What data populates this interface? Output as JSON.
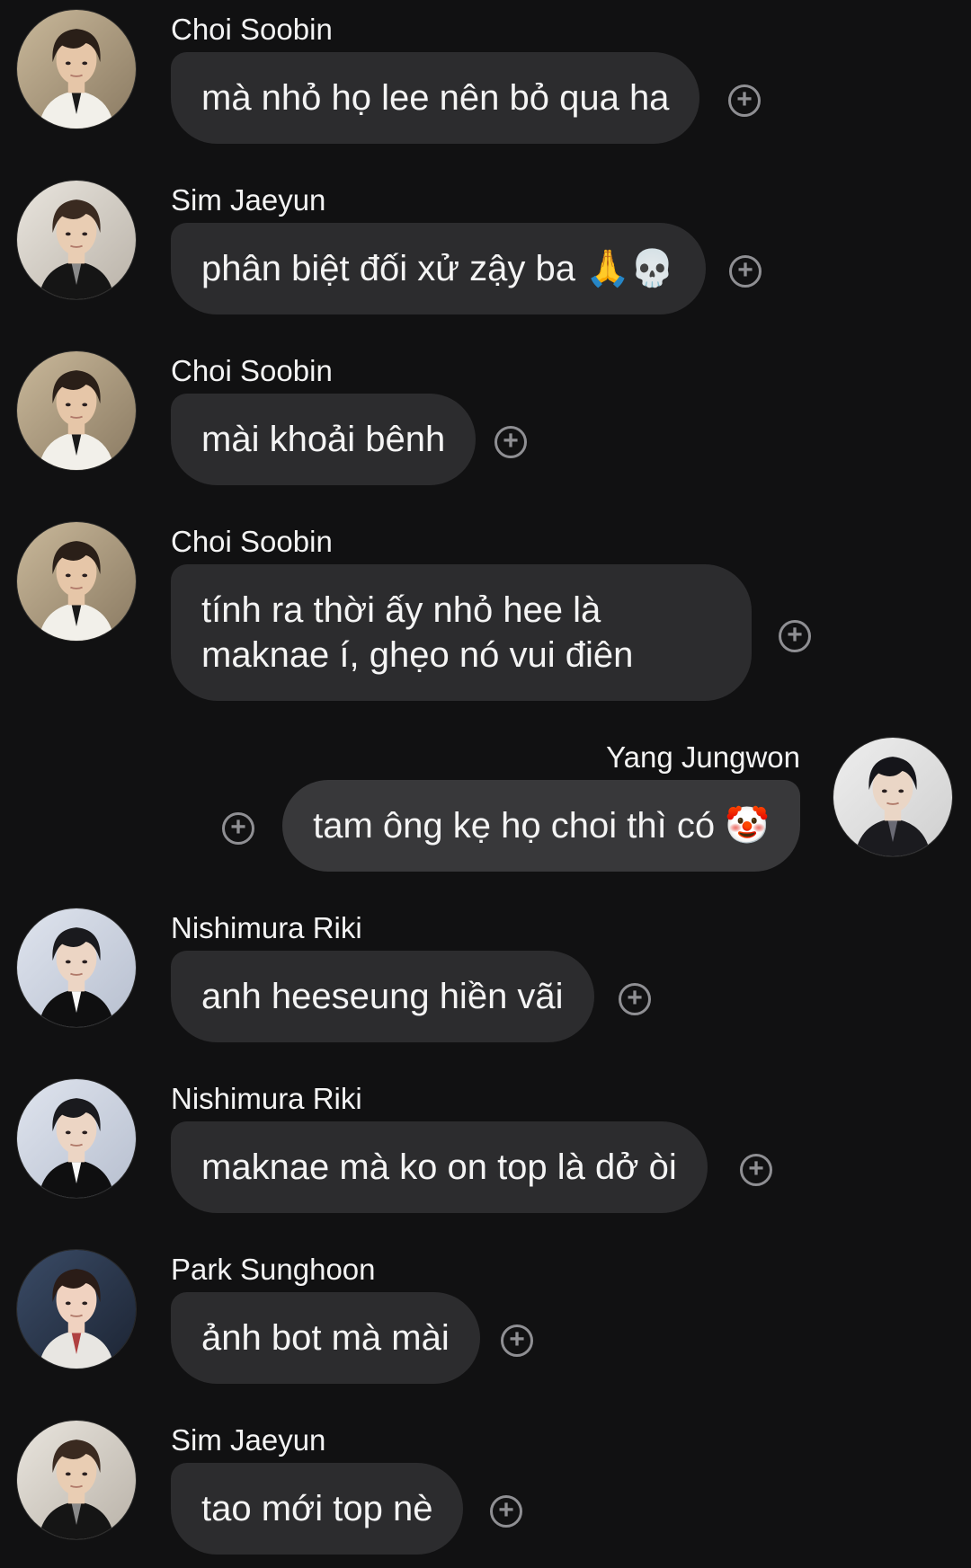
{
  "messages": [
    {
      "sender": "Choi Soobin",
      "text": "mà nhỏ họ lee nên bỏ qua ha",
      "side": "left",
      "avatar": "soobin"
    },
    {
      "sender": "Sim Jaeyun",
      "text": "phân biệt đối xử zậy ba 🙏💀",
      "side": "left",
      "avatar": "jaeyun"
    },
    {
      "sender": "Choi Soobin",
      "text": "mài khoải bênh",
      "side": "left",
      "avatar": "soobin"
    },
    {
      "sender": "Choi Soobin",
      "text": "tính ra thời ấy nhỏ hee là maknae í, ghẹo nó vui điên",
      "side": "left",
      "avatar": "soobin"
    },
    {
      "sender": "Yang Jungwon",
      "text": "tam ông kẹ họ choi thì có 🤡",
      "side": "right",
      "avatar": "jungwon"
    },
    {
      "sender": "Nishimura Riki",
      "text": "anh heeseung hiền vãi",
      "side": "left",
      "avatar": "riki"
    },
    {
      "sender": "Nishimura Riki",
      "text": "maknae mà ko on top là dở òi",
      "side": "left",
      "avatar": "riki"
    },
    {
      "sender": "Park Sunghoon",
      "text": "ảnh bot mà mài",
      "side": "left",
      "avatar": "sunghoon"
    },
    {
      "sender": "Sim Jaeyun",
      "text": "tao mới top nè",
      "side": "left",
      "avatar": "jaeyun"
    }
  ],
  "react_icon": "add-reaction-icon",
  "colors": {
    "background": "#111112",
    "bubble": "#2c2c2e",
    "text": "#f4f4f4",
    "icon": "#8f8f93"
  }
}
